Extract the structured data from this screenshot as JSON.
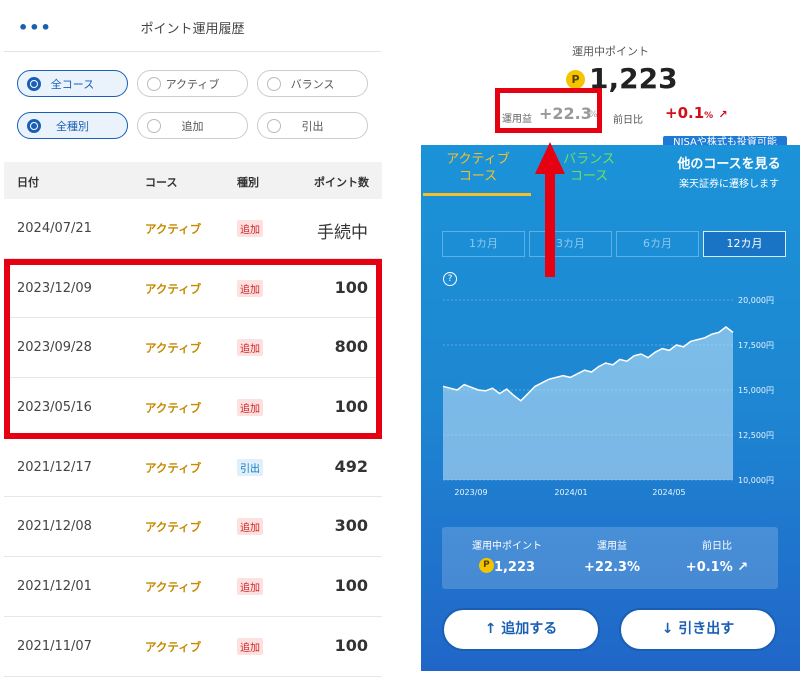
{
  "left": {
    "menu_icon": "more-icon",
    "title": "ポイント運用履歴",
    "filters_row1": [
      {
        "label": "全コース",
        "selected": true
      },
      {
        "label": "アクティブ",
        "selected": false
      },
      {
        "label": "バランス",
        "selected": false
      }
    ],
    "filters_row2": [
      {
        "label": "全種別",
        "selected": true
      },
      {
        "label": "追加",
        "selected": false
      },
      {
        "label": "引出",
        "selected": false
      }
    ],
    "headers": {
      "date": "日付",
      "course": "コース",
      "type": "種別",
      "points": "ポイント数"
    },
    "rows": [
      {
        "date": "2024/07/21",
        "course": "アクティブ",
        "type": "追加",
        "points": "手続中"
      },
      {
        "date": "2023/12/09",
        "course": "アクティブ",
        "type": "追加",
        "points": "100"
      },
      {
        "date": "2023/09/28",
        "course": "アクティブ",
        "type": "追加",
        "points": "800"
      },
      {
        "date": "2023/05/16",
        "course": "アクティブ",
        "type": "追加",
        "points": "100"
      },
      {
        "date": "2021/12/17",
        "course": "アクティブ",
        "type": "引出",
        "points": "492"
      },
      {
        "date": "2021/12/08",
        "course": "アクティブ",
        "type": "追加",
        "points": "300"
      },
      {
        "date": "2021/12/01",
        "course": "アクティブ",
        "type": "追加",
        "points": "100"
      },
      {
        "date": "2021/11/07",
        "course": "アクティブ",
        "type": "追加",
        "points": "100"
      }
    ]
  },
  "right": {
    "current_label": "運用中ポイント",
    "coin_symbol": "P",
    "current_value": "1,223",
    "gain_label": "運用益",
    "gain_value": "+22.3",
    "gain_unit": "%",
    "dod_label": "前日比",
    "dod_value": "+0.1",
    "dod_unit": "%",
    "nisa_banner": "NISAや株式も投資可能",
    "tab_active": [
      "アクティブ",
      "コース"
    ],
    "tab_other": [
      "バランス",
      "コース"
    ],
    "other_course_title": "他のコースを見る",
    "other_course_sub": "楽天証券に遷移します",
    "periods": [
      "1カ月",
      "3カ月",
      "6カ月",
      "12カ月"
    ],
    "period_selected": "12カ月",
    "summary": {
      "points_label": "運用中ポイント",
      "points_value": "1,223",
      "gain_label": "運用益",
      "gain_value": "+22.3%",
      "dod_label": "前日比",
      "dod_value": "+0.1%"
    },
    "add_button": "追加する",
    "withdraw_button": "引き出す"
  },
  "chart_data": {
    "type": "area",
    "x_ticks": [
      "2023/09",
      "2024/01",
      "2024/05"
    ],
    "y_ticks": [
      "20,000円",
      "17,500円",
      "15,000円",
      "12,500円",
      "10,000円"
    ],
    "ylim": [
      10000,
      20000
    ],
    "series": [
      {
        "values": [
          15200,
          15100,
          15000,
          15300,
          15150,
          15000,
          14950,
          15100,
          14800,
          15050,
          14700,
          14400,
          14800,
          15200,
          15400,
          15600,
          15700,
          15800,
          15700,
          15900,
          16100,
          16000,
          16300,
          16500,
          16400,
          16700,
          16600,
          16900,
          17000,
          16800,
          17100,
          17300,
          17200,
          17500,
          17400,
          17700,
          17800,
          17900,
          18100,
          18200,
          18500,
          18200
        ]
      }
    ]
  }
}
